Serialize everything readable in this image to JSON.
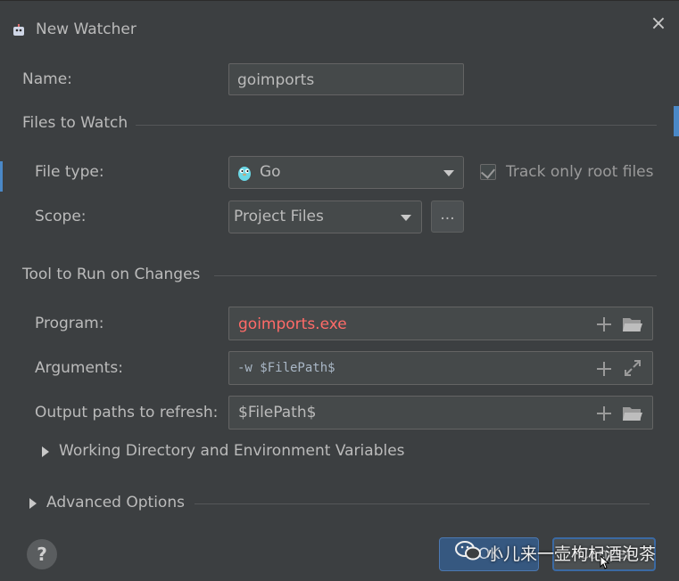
{
  "window": {
    "title": "New Watcher",
    "close_label": "×"
  },
  "name": {
    "label": "Name:",
    "value": "goimports"
  },
  "files_to_watch": {
    "section_label": "Files to Watch",
    "file_type": {
      "label": "File type:",
      "value": "Go",
      "icon": "gopher-icon"
    },
    "track_only_root": {
      "label": "Track only root files",
      "checked": true
    },
    "scope": {
      "label": "Scope:",
      "value": "Project Files",
      "browse_label": "..."
    }
  },
  "tool": {
    "section_label": "Tool to Run on Changes",
    "program": {
      "label": "Program:",
      "value": "goimports.exe",
      "color": "#ff6b68"
    },
    "arguments": {
      "label": "Arguments:",
      "value": "-w $FilePath$"
    },
    "output_paths": {
      "label": "Output paths to refresh:",
      "value": "$FilePath$"
    },
    "working_dir_label": "Working Directory and Environment Variables"
  },
  "advanced_label": "Advanced Options",
  "footer": {
    "help_label": "?",
    "ok_label": "OK",
    "cancel_label": "Cancel"
  },
  "watermark": "小儿来一壶枸杞酒泡茶",
  "colors": {
    "background": "#3c3f41",
    "field": "#45494a",
    "accent": "#365880",
    "error_text": "#ff6b68"
  }
}
